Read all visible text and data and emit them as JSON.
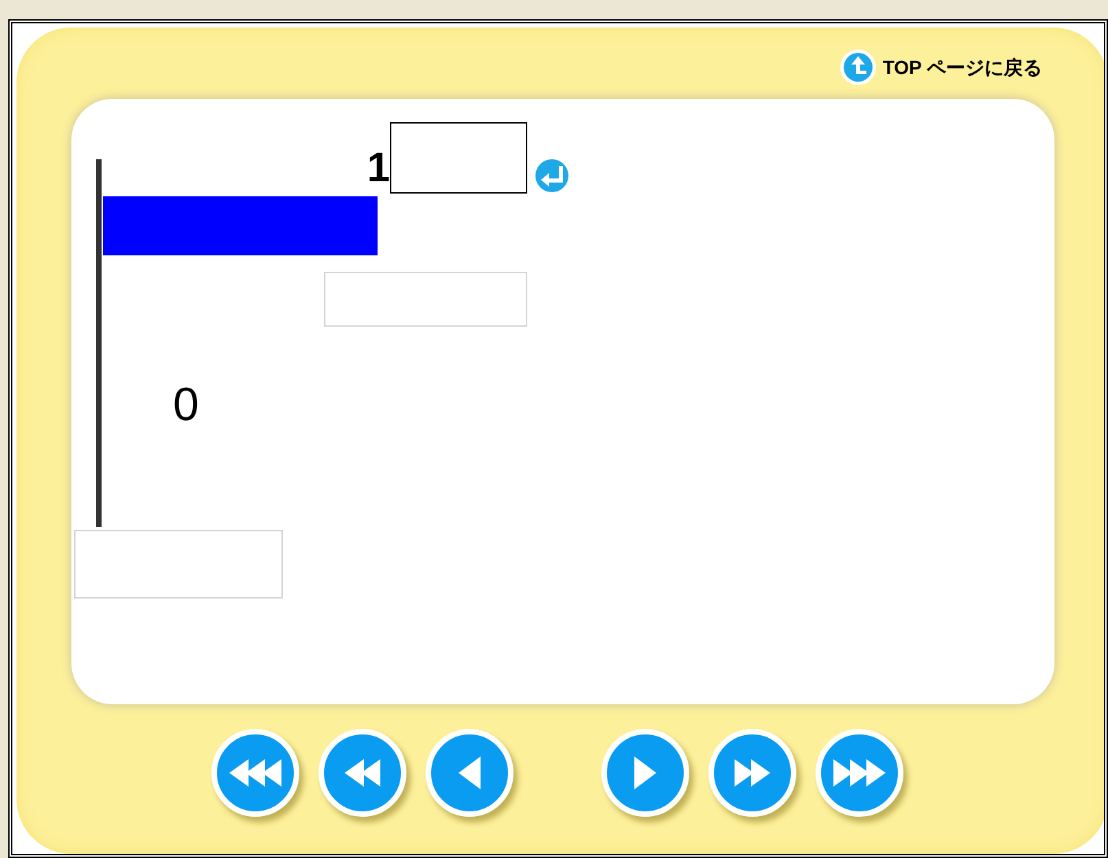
{
  "top_link": {
    "label": "TOP ページに戻る"
  },
  "exercise": {
    "top_label": "1",
    "bottom_label": "0"
  },
  "nav_buttons": [
    {
      "kind": "first"
    },
    {
      "kind": "rewind"
    },
    {
      "kind": "back"
    },
    {
      "kind": "forward"
    },
    {
      "kind": "fastforward"
    },
    {
      "kind": "last"
    }
  ]
}
